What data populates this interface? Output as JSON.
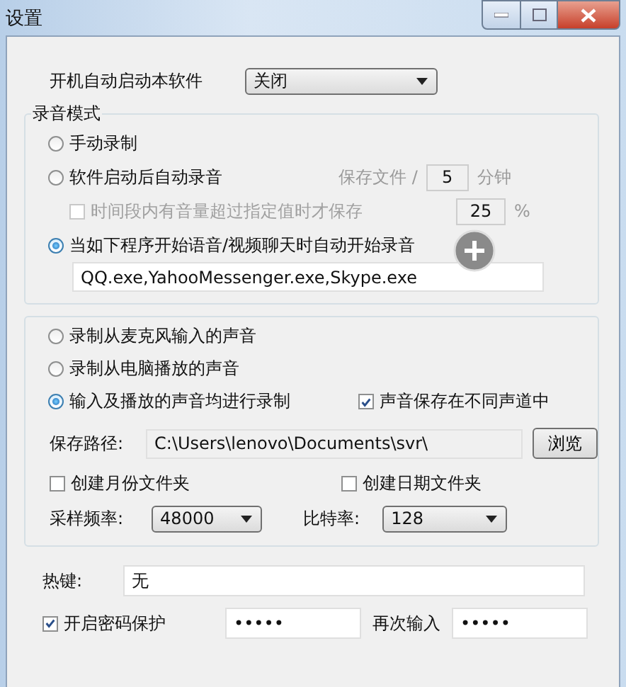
{
  "window": {
    "title": "设置"
  },
  "startup": {
    "label": "开机自动启动本软件",
    "value": "关闭"
  },
  "recording_mode": {
    "title": "录音模式",
    "options": [
      {
        "label": "手动录制",
        "selected": false
      },
      {
        "label": "软件启动后自动录音",
        "selected": false
      },
      {
        "label": "当如下程序开始语音/视频聊天时自动开始录音",
        "selected": true
      }
    ],
    "save_every": {
      "label": "保存文件 /",
      "value": "5",
      "unit": "分钟",
      "disabled": true
    },
    "threshold": {
      "label": "时间段内有音量超过指定值时才保存",
      "checked": false,
      "disabled": true,
      "value": "25",
      "unit": "%"
    },
    "programs": {
      "value": "QQ.exe,YahooMessenger.exe,Skype.exe"
    }
  },
  "source": {
    "options": [
      {
        "label": "录制从麦克风输入的声音",
        "selected": false
      },
      {
        "label": "录制从电脑播放的声音",
        "selected": false
      },
      {
        "label": "输入及播放的声音均进行录制",
        "selected": true
      }
    ],
    "separate_channels": {
      "label": "声音保存在不同声道中",
      "checked": true
    },
    "save_path": {
      "label": "保存路径:",
      "value": "C:\\Users\\lenovo\\Documents\\svr\\",
      "button": "浏览"
    },
    "month_folder": {
      "label": "创建月份文件夹",
      "checked": false
    },
    "date_folder": {
      "label": "创建日期文件夹",
      "checked": false
    },
    "sample_rate": {
      "label": "采样频率:",
      "value": "48000"
    },
    "bitrate": {
      "label": "比特率:",
      "value": "128"
    }
  },
  "hotkey": {
    "label": "热键:",
    "value": "无"
  },
  "password": {
    "label": "开启密码保护",
    "checked": true,
    "value": "•••••",
    "confirm_label": "再次输入",
    "confirm_value": "•••••"
  }
}
